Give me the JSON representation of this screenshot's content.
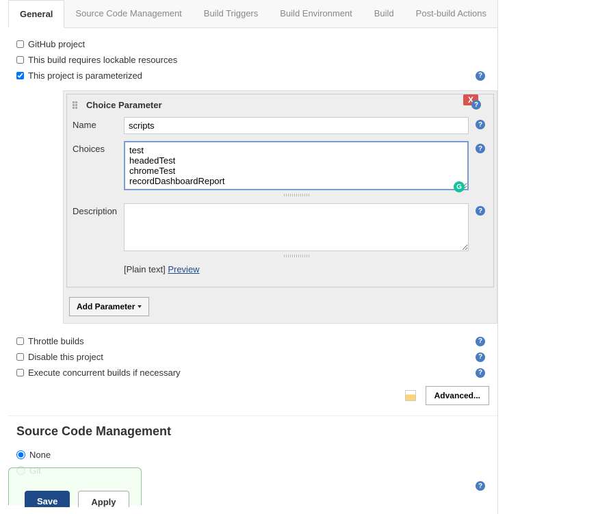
{
  "tabs": {
    "general": "General",
    "scm": "Source Code Management",
    "triggers": "Build Triggers",
    "env": "Build Environment",
    "build": "Build",
    "post": "Post-build Actions"
  },
  "checkboxes": {
    "github": "GitHub project",
    "lockable": "This build requires lockable resources",
    "parameterized": "This project is parameterized",
    "throttle": "Throttle builds",
    "disable": "Disable this project",
    "concurrent": "Execute concurrent builds if necessary"
  },
  "parameter": {
    "title": "Choice Parameter",
    "name_label": "Name",
    "choices_label": "Choices",
    "description_label": "Description",
    "name_value": "scripts",
    "choices_value": "test\nheadedTest\nchromeTest\nrecordDashboardReport",
    "preview_text": "[Plain text]",
    "preview_link": "Preview"
  },
  "buttons": {
    "add_parameter": "Add Parameter",
    "advanced": "Advanced...",
    "save": "Save",
    "apply": "Apply"
  },
  "scm": {
    "heading": "Source Code Management",
    "none": "None",
    "git": "Git"
  },
  "help_icon_text": "?",
  "close_text": "X",
  "grammarly_text": "G"
}
